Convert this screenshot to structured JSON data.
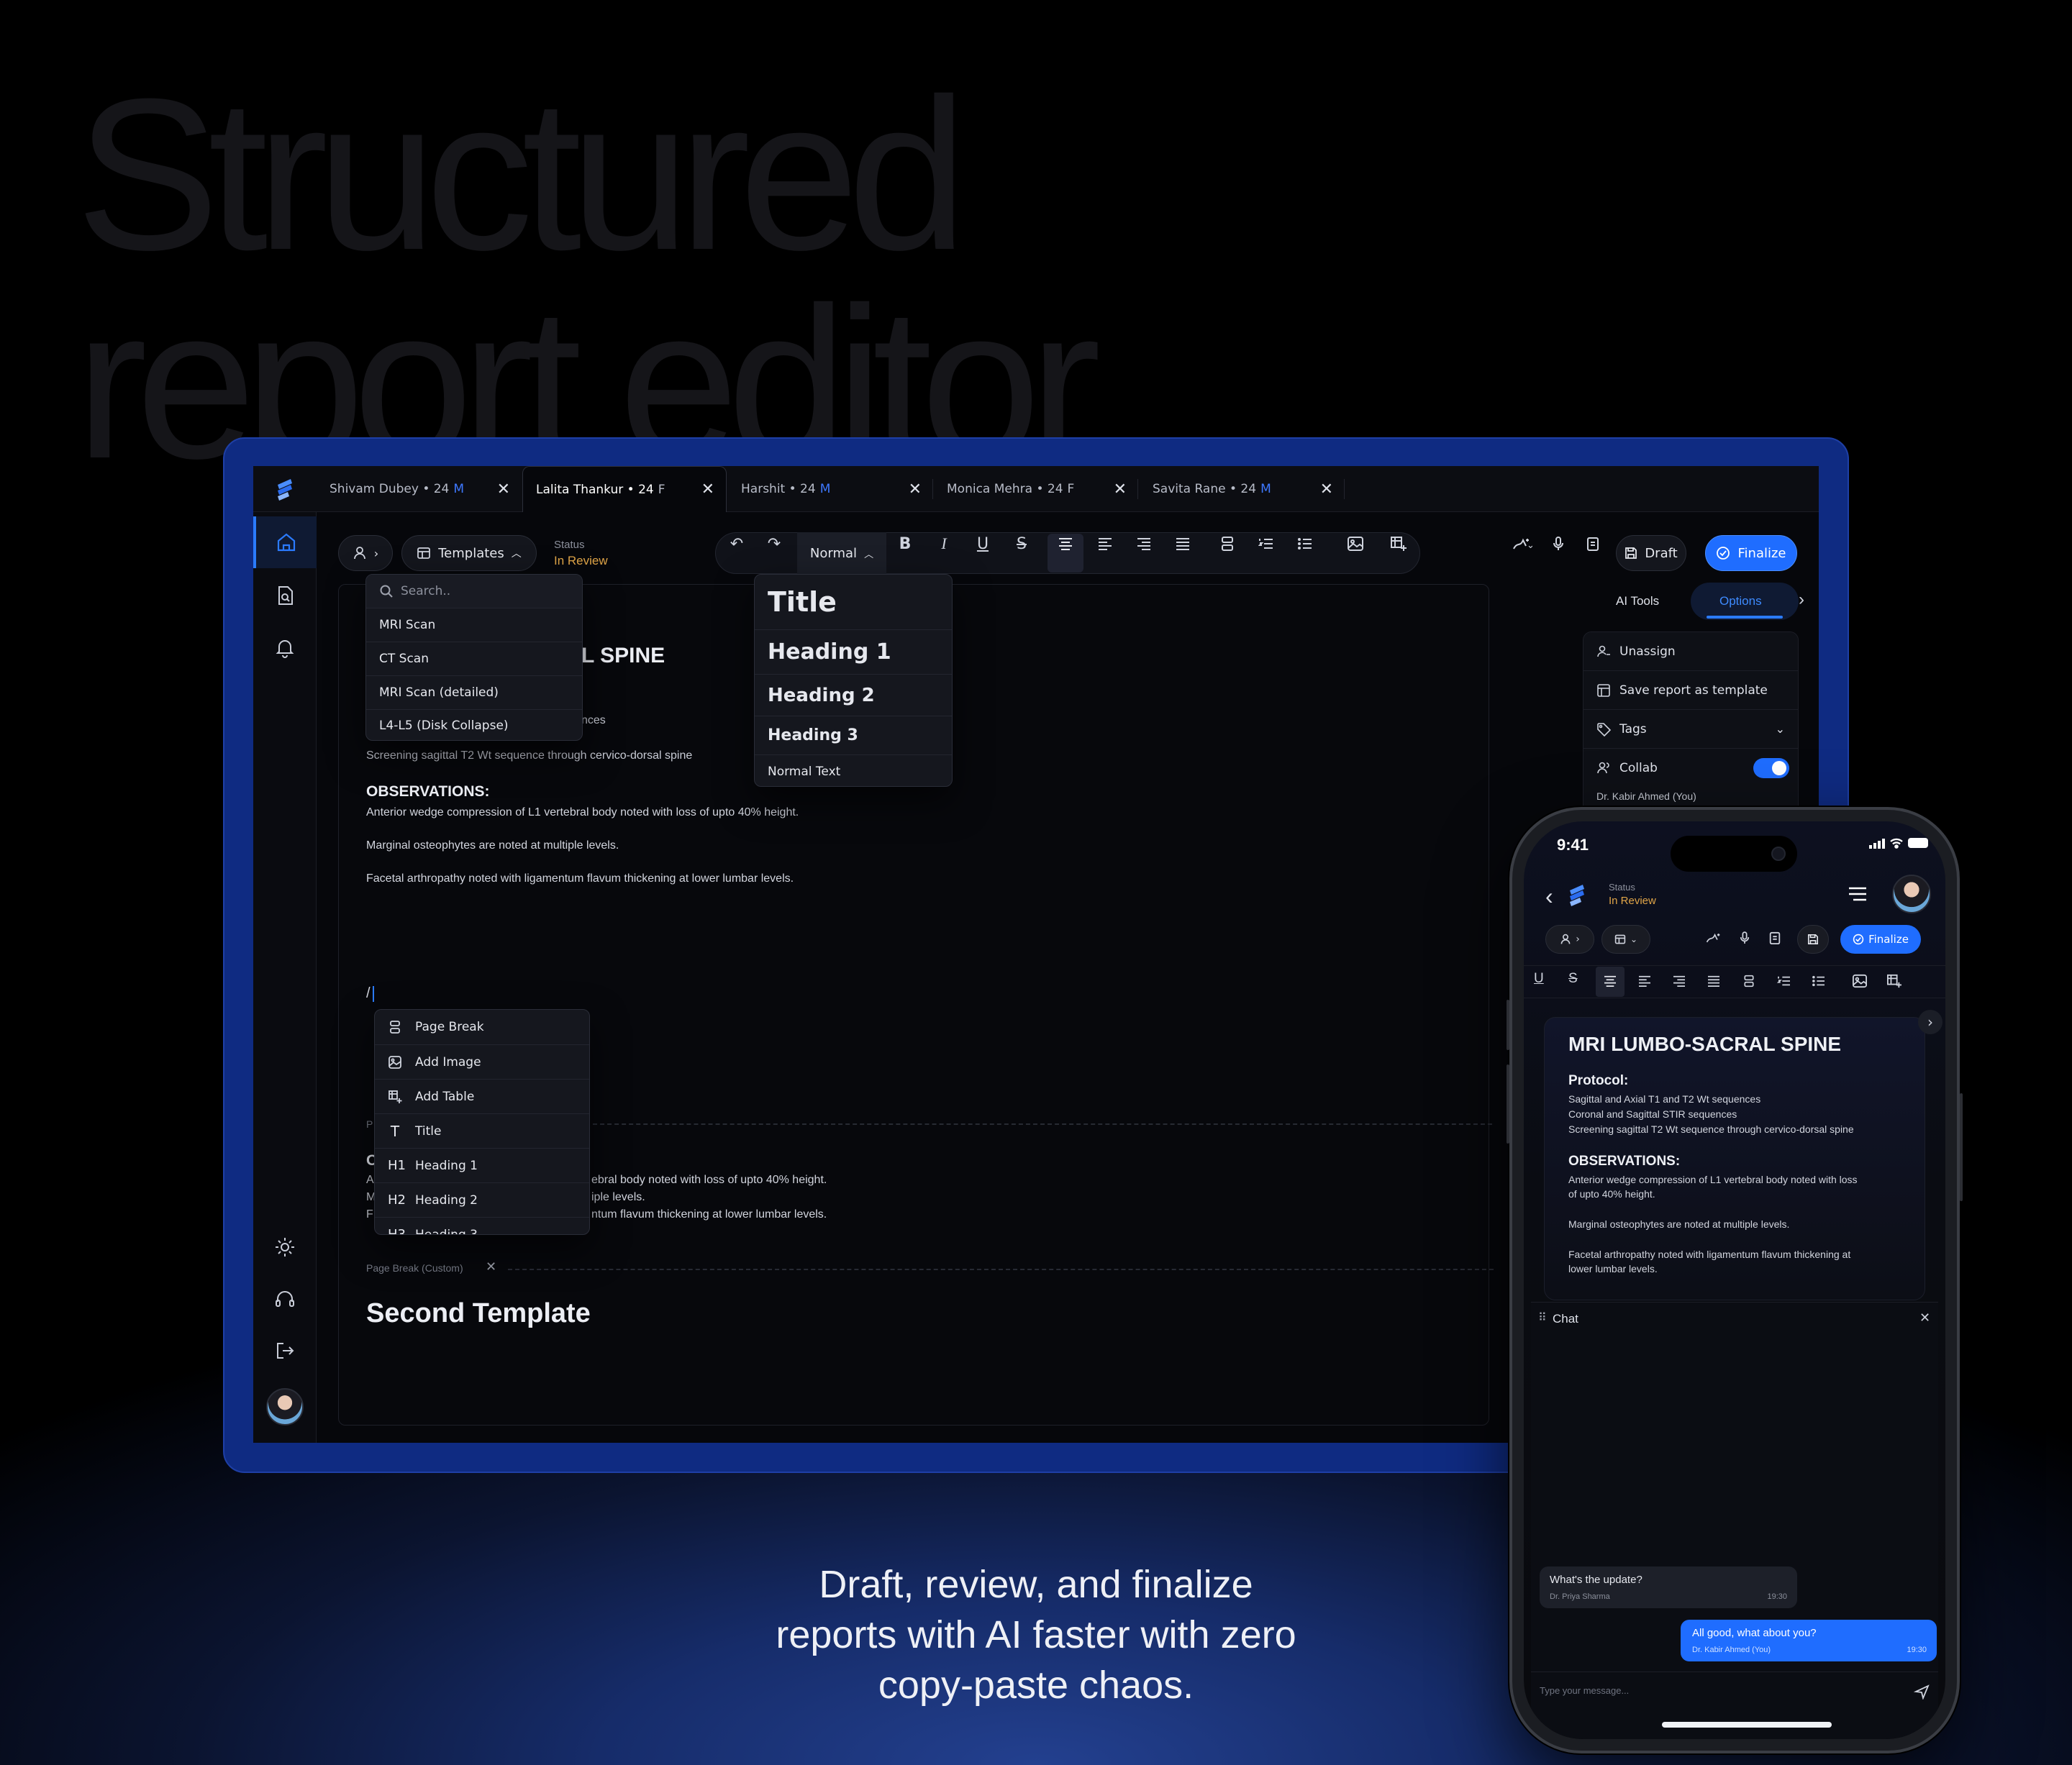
{
  "hero": {
    "line1": "Structured",
    "line2": "report editor"
  },
  "tagline": {
    "line1": "Draft, review, and finalize",
    "line2": "reports with AI faster with zero",
    "line3": "copy-paste chaos."
  },
  "tabs": [
    {
      "name": "Shivam Dubey",
      "age": "• 24",
      "sex": "M"
    },
    {
      "name": "Lalita Thankur",
      "age": "• 24",
      "sex": "F"
    },
    {
      "name": "Harshit",
      "age": "• 24",
      "sex": "M"
    },
    {
      "name": "Monica Mehra",
      "age": "• 24",
      "sex": "F"
    },
    {
      "name": "Savita Rane",
      "age": "• 24",
      "sex": "M"
    }
  ],
  "toolbar": {
    "templates_label": "Templates",
    "status_label": "Status",
    "status_value": "In Review",
    "style_select": "Normal",
    "draft_label": "Draft",
    "finalize_label": "Finalize"
  },
  "templates_dropdown": {
    "search_placeholder": "Search..",
    "items": [
      "MRI Scan",
      "CT Scan",
      "MRI Scan (detailed)",
      "L4-L5 (Disk Collapse)"
    ]
  },
  "style_dropdown": {
    "items": [
      "Title",
      "Heading 1",
      "Heading 2",
      "Heading 3",
      "Normal Text"
    ]
  },
  "document": {
    "title_fragment": "L SPINE",
    "protocol_fragment": "nces",
    "protocol_line3": "Screening sagittal T2 Wt sequence through cervico-dorsal spine",
    "observations_heading": "OBSERVATIONS:",
    "obs1": "Anterior wedge compression of L1 vertebral body noted with loss of upto 40% height.",
    "obs2": "Marginal osteophytes are noted at multiple levels.",
    "obs3": "Facetal arthropathy noted with ligamentum flavum thickening at lower lumbar levels.",
    "slash": "/",
    "frag_p": "P",
    "frag_o": "O",
    "frag_a": "A",
    "frag_m": "M",
    "frag_f": "F",
    "frag_obs1": "ebral body noted with loss of upto 40% height.",
    "frag_obs2": "iple levels.",
    "frag_obs3": "ntum flavum thickening at lower lumbar levels.",
    "page_break_label": "Page Break (Custom)",
    "second_template": "Second Template"
  },
  "slash_menu": {
    "items": [
      {
        "icon": "",
        "label": "Page Break"
      },
      {
        "icon": "",
        "label": "Add Image"
      },
      {
        "icon": "",
        "label": "Add Table"
      },
      {
        "icon": "T",
        "label": "Title"
      },
      {
        "icon": "H1",
        "label": "Heading 1"
      },
      {
        "icon": "H2",
        "label": "Heading 2"
      },
      {
        "icon": "H3",
        "label": "Heading 3"
      }
    ]
  },
  "right_panel": {
    "tab_ai": "AI Tools",
    "tab_options": "Options",
    "unassign": "Unassign",
    "save_template": "Save report as template",
    "tags": "Tags",
    "collab": "Collab",
    "collab_user": "Dr. Kabir Ahmed (You)"
  },
  "phone": {
    "time": "9:41",
    "status_label": "Status",
    "status_value": "In Review",
    "finalize_label": "Finalize",
    "doc_title": "MRI LUMBO-SACRAL SPINE",
    "protocol_heading": "Protocol:",
    "protocol": [
      "Sagittal and Axial T1 and T2 Wt sequences",
      "Coronal and Sagittal STIR sequences",
      "Screening sagittal T2 Wt sequence through cervico-dorsal spine"
    ],
    "observations_heading": "OBSERVATIONS:",
    "obs1a": "Anterior wedge compression of L1 vertebral body noted with loss",
    "obs1b": "of upto 40% height.",
    "obs2": "Marginal osteophytes are noted at multiple levels.",
    "obs3a": "Facetal arthropathy noted with ligamentum flavum thickening at",
    "obs3b": "lower lumbar levels.",
    "chat_title": "Chat",
    "msg1": {
      "text": "What's the update?",
      "author": "Dr. Priya Sharma",
      "time": "19:30"
    },
    "msg2": {
      "text": "All good, what about you?",
      "author": "Dr. Kabir Ahmed (You)",
      "time": "19:30"
    },
    "input_placeholder": "Type your message..."
  },
  "colors": {
    "accent": "#2b7bff",
    "status": "#e0a548",
    "male": "#3e78ff"
  }
}
